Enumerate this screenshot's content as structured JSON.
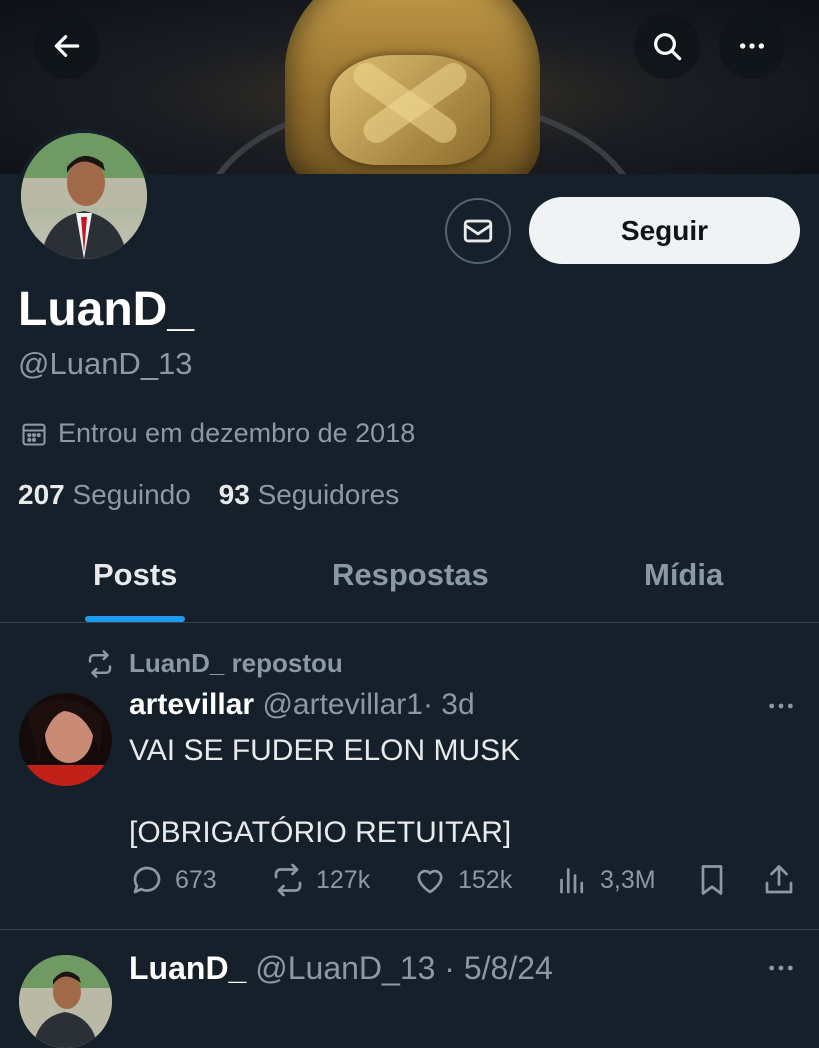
{
  "header": {
    "back_icon": "arrow-left-icon",
    "search_icon": "search-icon",
    "more_icon": "more-horizontal-icon"
  },
  "profile": {
    "display_name": "LuanD_",
    "handle": "@LuanD_13",
    "joined": "Entrou em dezembro de 2018",
    "following_count": "207",
    "following_label": "Seguindo",
    "followers_count": "93",
    "followers_label": "Seguidores",
    "follow_button": "Seguir",
    "message_icon": "mail-icon"
  },
  "tabs": [
    {
      "label": "Posts",
      "active": true
    },
    {
      "label": "Respostas",
      "active": false
    },
    {
      "label": "Mídia",
      "active": false
    }
  ],
  "posts": [
    {
      "repost_label": "LuanD_ repostou",
      "author_name": "artevillar",
      "author_handle": "@artevillar1",
      "time": "· 3d",
      "text_line1": "VAI SE FUDER ELON MUSK",
      "text_line2": "[OBRIGATÓRIO RETUITAR]",
      "replies": "673",
      "reposts": "127k",
      "likes": "152k",
      "views": "3,3M"
    },
    {
      "author_name": "LuanD_",
      "author_handle": "@LuanD_13",
      "time": "· 5/8/24"
    }
  ],
  "colors": {
    "background": "#15202b",
    "accent": "#1d9bf0",
    "secondary_text": "#8b98a5",
    "primary_text": "#e7e9ea"
  }
}
